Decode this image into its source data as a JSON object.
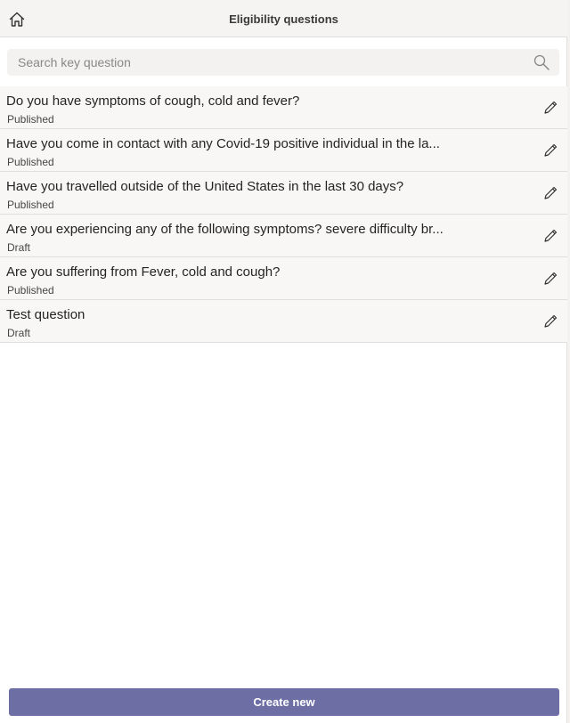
{
  "header": {
    "title": "Eligibility questions",
    "home_icon": "home-icon"
  },
  "search": {
    "placeholder": "Search key question",
    "value": "",
    "icon": "search-icon"
  },
  "questions": [
    {
      "title": "Do you have symptoms of cough, cold and fever?",
      "status": "Published",
      "action_icon": "pencil-icon"
    },
    {
      "title": "Have you come in contact with any Covid-19 positive individual in the la...",
      "status": "Published",
      "action_icon": "pencil-icon"
    },
    {
      "title": "Have you travelled outside of the United States in the last 30 days?",
      "status": "Published",
      "action_icon": "pencil-icon"
    },
    {
      "title": "Are you experiencing any of the following symptoms? severe difficulty br...",
      "status": "Draft",
      "action_icon": "pencil-icon"
    },
    {
      "title": "Are you suffering from Fever, cold and cough?",
      "status": "Published",
      "action_icon": "pencil-icon"
    },
    {
      "title": "Test question",
      "status": "Draft",
      "action_icon": "pencil-icon"
    }
  ],
  "footer": {
    "create_label": "Create new"
  },
  "colors": {
    "accent": "#6c6ea4",
    "header_bg": "#f5f4f3",
    "row_bg": "#f8f7f6"
  }
}
